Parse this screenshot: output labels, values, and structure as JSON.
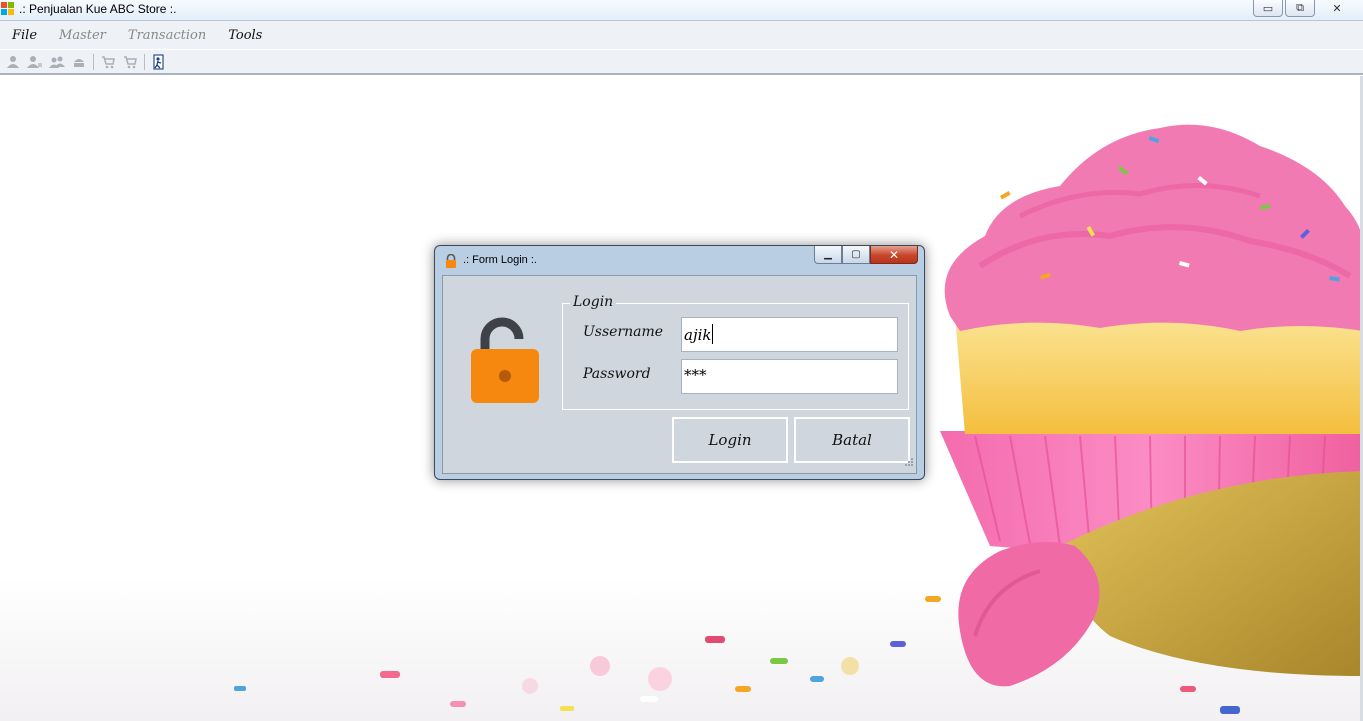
{
  "window": {
    "title": ".: Penjualan Kue ABC Store :.",
    "controls": {
      "minimize": "▭",
      "restore": "⧉",
      "close": "✕"
    }
  },
  "menu": {
    "items": [
      {
        "label": "File",
        "enabled": true
      },
      {
        "label": "Master",
        "enabled": false
      },
      {
        "label": "Transaction",
        "enabled": false
      },
      {
        "label": "Tools",
        "enabled": true
      }
    ]
  },
  "toolbar": {
    "icons": [
      "user-icon",
      "users-icon",
      "user-group-icon",
      "cake-icon",
      "cart-icon",
      "cart-icon",
      "logout-icon"
    ]
  },
  "dialog": {
    "title": ".: Form Login :.",
    "group_title": "Login",
    "username_label": "Ussername",
    "username_value": "ajik",
    "password_label": "Password",
    "password_value": "***",
    "login_button": "Login",
    "cancel_button": "Batal"
  },
  "colors": {
    "lock": "#f7880f",
    "dialog_frame": "#b9cde3",
    "dialog_client": "#d0d6de",
    "frosting": "#f06aa6",
    "cake": "#f9d66b"
  }
}
